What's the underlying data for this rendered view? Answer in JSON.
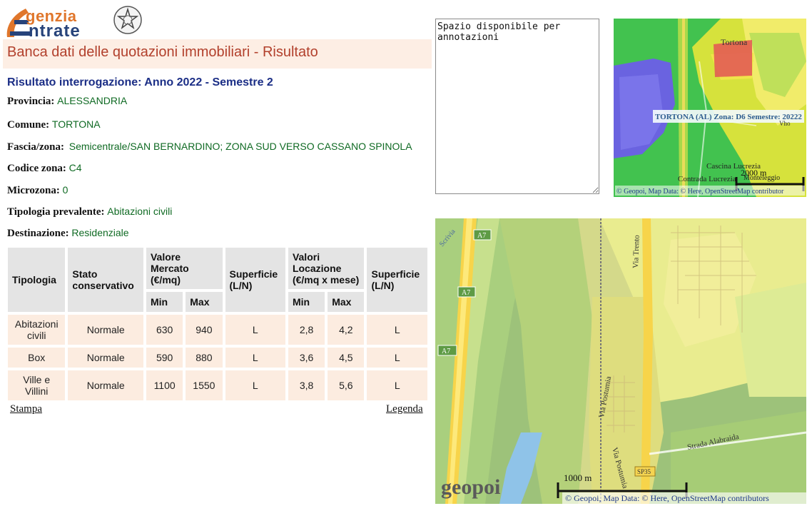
{
  "logo": {
    "line1": "genzia",
    "line2": "ntrate"
  },
  "header": {
    "title": "Banca dati delle quotazioni immobiliari - Risultato"
  },
  "result": {
    "title": "Risultato interrogazione: Anno 2022 - Semestre 2",
    "fields": {
      "provincia": {
        "label": "Provincia:",
        "value": "ALESSANDRIA"
      },
      "comune": {
        "label": "Comune:",
        "value": "TORTONA"
      },
      "fascia": {
        "label": "Fascia/zona:",
        "value": "Semicentrale/SAN BERNARDINO; ZONA SUD VERSO CASSANO SPINOLA"
      },
      "codice": {
        "label": "Codice zona:",
        "value": "C4"
      },
      "microzona": {
        "label": "Microzona:",
        "value": "0"
      },
      "tipologia": {
        "label": "Tipologia prevalente:",
        "value": "Abitazioni civili"
      },
      "destinazione": {
        "label": "Destinazione:",
        "value": "Residenziale"
      }
    }
  },
  "table": {
    "headers": {
      "tipologia": "Tipologia",
      "stato": "Stato conservativo",
      "valore": "Valore Mercato (€/mq)",
      "superficie1": "Superficie (L/N)",
      "locazione": "Valori Locazione (€/mq x mese)",
      "superficie2": "Superficie (L/N)",
      "min": "Min",
      "max": "Max"
    },
    "rows": [
      {
        "tipologia": "Abitazioni civili",
        "stato": "Normale",
        "vm_min": "630",
        "vm_max": "940",
        "sup1": "L",
        "loc_min": "2,8",
        "loc_max": "4,2",
        "sup2": "L"
      },
      {
        "tipologia": "Box",
        "stato": "Normale",
        "vm_min": "590",
        "vm_max": "880",
        "sup1": "L",
        "loc_min": "3,6",
        "loc_max": "4,5",
        "sup2": "L"
      },
      {
        "tipologia": "Ville e Villini",
        "stato": "Normale",
        "vm_min": "1100",
        "vm_max": "1550",
        "sup1": "L",
        "loc_min": "3,8",
        "loc_max": "5,6",
        "sup2": "L"
      }
    ]
  },
  "links": {
    "stampa": "Stampa",
    "legenda": "Legenda"
  },
  "notes": {
    "value": "Spazio disponibile per annotazioni"
  },
  "map_small": {
    "city_label": "Tortona",
    "zone_label": "TORTONA (AL) Zona: D6 Semestre: 20222",
    "place1": "Cascina Lucrezia",
    "place2": "Contrada Lucrezia",
    "place3": "Monteleggio",
    "place4": "Vho",
    "scale": "2000 m",
    "attribution": "© Geopoi, Map Data: © Here, OpenStreetMap contributor"
  },
  "map_big": {
    "road_a7_1": "A7",
    "road_a7_2": "A7",
    "road_a7_3": "A7",
    "road_sp35": "SP35",
    "street1": "Via Trento",
    "street2": "Via Postumia",
    "street3": "Via Postumia",
    "street4": "Strada Alabraida",
    "street5": "Scrivia",
    "brand": "geopoi",
    "scale": "1000 m",
    "attribution": "© Geopoi, Map Data: © Here, OpenStreetMap contributors"
  },
  "colors": {
    "title_band_bg": "#fdeee4",
    "title_text": "#b2402c",
    "result_title": "#1b2e86",
    "value_green": "#0f6a23",
    "cell_bg": "#fcece0",
    "header_bg": "#e4e4e4"
  }
}
